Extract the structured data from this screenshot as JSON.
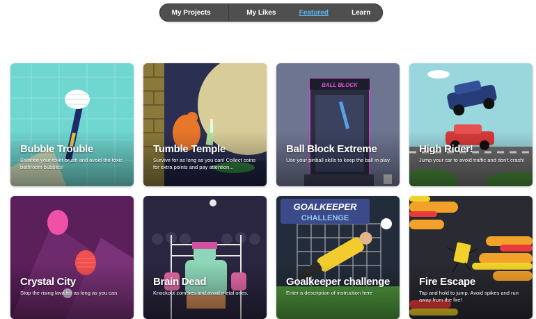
{
  "nav": {
    "items": [
      {
        "label": "My Projects"
      },
      {
        "label": "My Likes"
      },
      {
        "label": "Featured"
      },
      {
        "label": "Learn"
      }
    ],
    "active_index": 2,
    "active_color": "#5bb8f0"
  },
  "cards": [
    {
      "title": "Bubble Trouble",
      "description": "Balance your toilet brush and avoid the toxic bathroom bubbles!"
    },
    {
      "title": "Tumble Temple",
      "description": "Survive for as long as you can! Collect coins for extra points and pay attention..."
    },
    {
      "title": "Ball Block Extreme",
      "description": "Use your pinball skills to keep the ball in play.",
      "sign": "BALL BLOCK"
    },
    {
      "title": "High Rider!",
      "description": "Jump your car to avoid traffic and don't crash!"
    },
    {
      "title": "Crystal City",
      "description": "Stop the rising lava for as long as you can."
    },
    {
      "title": "Brain Dead",
      "description": "Knockout zombies and avoid metal ones."
    },
    {
      "title": "Goalkeeper challenge",
      "description": "Enter a description of instruction here",
      "banner_line1": "GOALKEEPER",
      "banner_line2": "CHALLENGE"
    },
    {
      "title": "Fire Escape",
      "description": "Tap and hold to jump. Avoid spikes and run away from the fire!"
    }
  ]
}
